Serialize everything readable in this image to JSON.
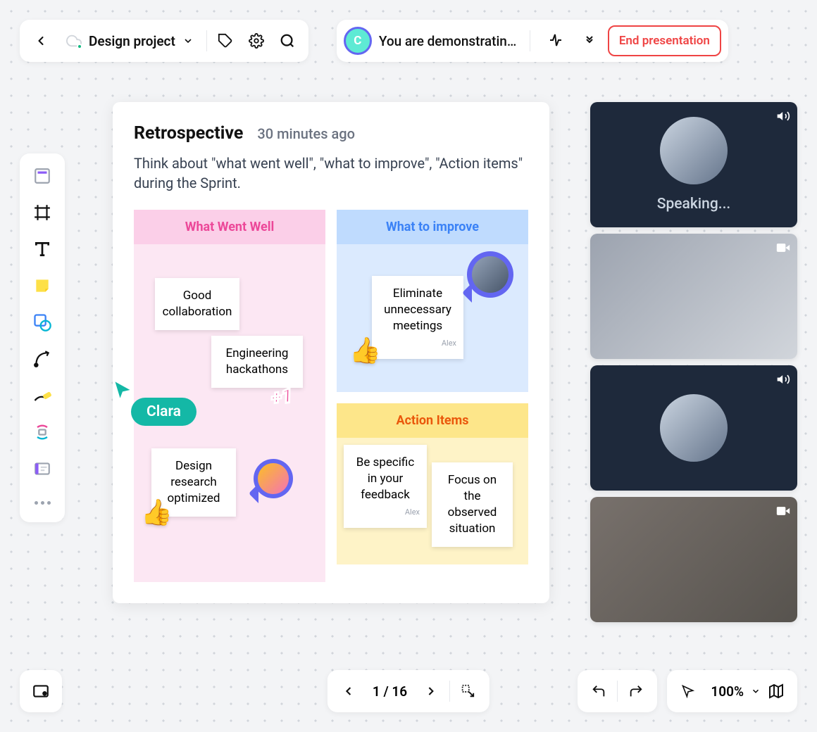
{
  "header": {
    "project_name": "Design project",
    "presentation_status": "You are demonstrating...",
    "presenter_initial": "C",
    "end_button": "End presentation"
  },
  "board": {
    "title": "Retrospective",
    "timestamp": "30 minutes ago",
    "description": "Think about \"what went well\", \"what to improve\", \"Action items\" during the Sprint.",
    "columns": {
      "well": {
        "title": "What Went Well"
      },
      "improve": {
        "title": "What to improve"
      },
      "actions": {
        "title": "Action Items"
      }
    },
    "notes": {
      "collaboration": "Good collaboration",
      "hackathons": "Engineering hackathons",
      "research": "Design research optimized",
      "meetings": "Eliminate unnecessary meetings",
      "meetings_author": "Alex",
      "feedback": "Be specific in your feedback",
      "feedback_author": "Alex",
      "observed": "Focus on the observed situation"
    },
    "cursor_label": "Clara",
    "plus_one": "+1"
  },
  "video": {
    "tile1_label": "Speaking..."
  },
  "footer": {
    "page_indicator": "1 / 16",
    "zoom": "100%"
  }
}
